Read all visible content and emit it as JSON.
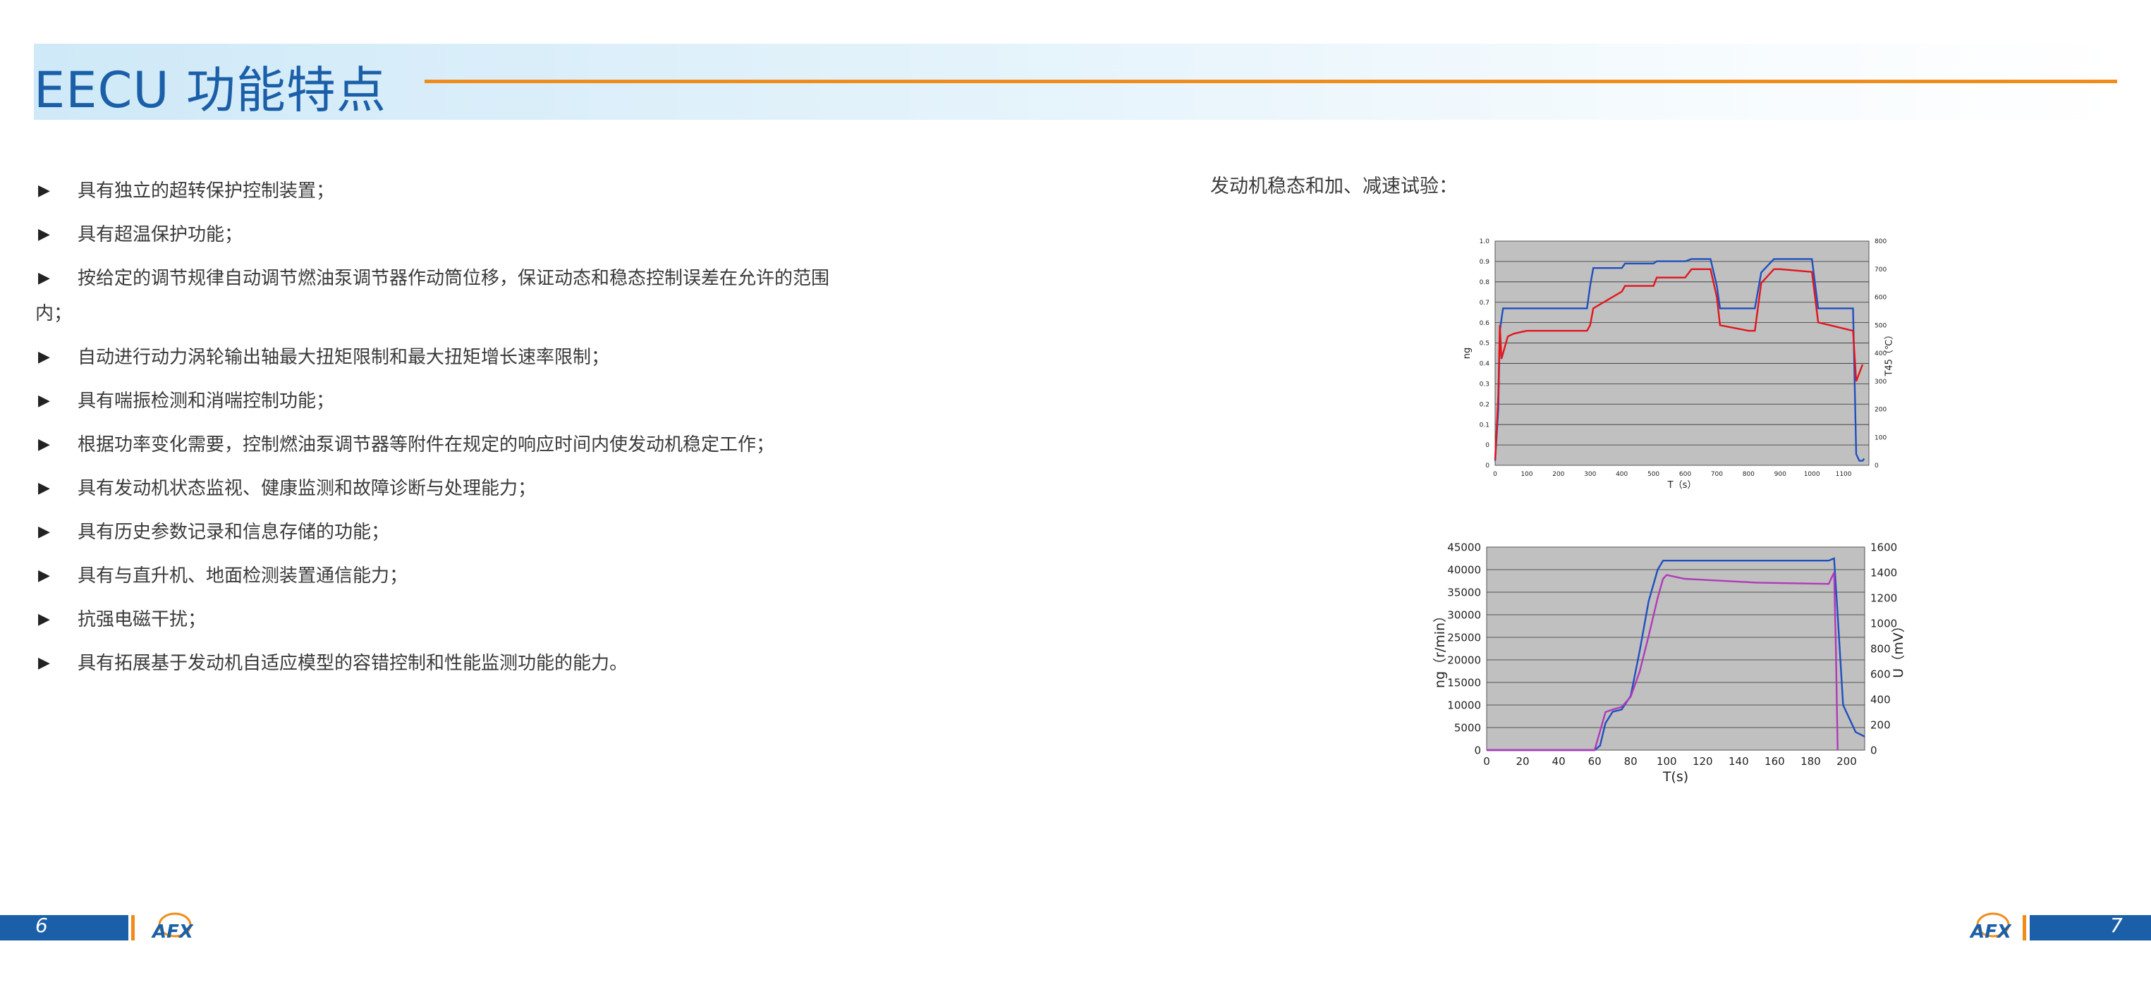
{
  "header": {
    "title": "EECU 功能特点"
  },
  "features": [
    "具有独立的超转保护控制装置；",
    "具有超温保护功能；",
    "按给定的调节规律自动调节燃油泵调节器作动筒位移，保证动态和稳态控制误差在允许的范围内；",
    "自动进行动力涡轮输出轴最大扭矩限制和最大扭矩增长速率限制；",
    "具有喘振检测和消喘控制功能；",
    "根据功率变化需要，控制燃油泵调节器等附件在规定的响应时间内使发动机稳定工作；",
    "具有发动机状态监视、健康监测和故障诊断与处理能力；",
    "具有历史参数记录和信息存储的功能；",
    "具有与直升机、地面检测装置通信能力；",
    "抗强电磁干扰；",
    "具有拓展基于发动机自适应模型的容错控制和性能监测功能的能力。"
  ],
  "bullet_glyph": "▶",
  "chart_caption": "发动机稳态和加、减速试验：",
  "footer": {
    "left_page": "6",
    "right_page": "7",
    "logo_text": "AFX"
  },
  "colors": {
    "brand_blue": "#1a5fa8",
    "accent_orange": "#f08c1a",
    "plot_bg": "#c0c0c0"
  },
  "chart_data": [
    {
      "type": "line",
      "xlabel": "T（s）",
      "ylabel": "ng",
      "y2label": "T45（℃）",
      "xlim": [
        0,
        1180
      ],
      "ylim": [
        0,
        1.0
      ],
      "y2lim": [
        0,
        800
      ],
      "x_ticks": [
        "0",
        "100",
        "200",
        "300",
        "400",
        "500",
        "600",
        "700",
        "800",
        "900",
        "1000",
        "1100"
      ],
      "y_ticks": [
        "0",
        "0",
        "0.1",
        "0.2",
        "0.3",
        "0.4",
        "0.5",
        "0.6",
        "0.7",
        "0.8",
        "0.9",
        "1.0"
      ],
      "y2_ticks": [
        "0",
        "100",
        "200",
        "300",
        "400",
        "500",
        "600",
        "700",
        "800"
      ],
      "grid": true,
      "series": [
        {
          "color": "#1f4fbf",
          "axis": "left",
          "x": [
            0,
            10,
            15,
            25,
            50,
            290,
            300,
            310,
            400,
            410,
            500,
            510,
            600,
            620,
            640,
            680,
            700,
            710,
            800,
            820,
            840,
            880,
            900,
            1000,
            1020,
            1130,
            1140,
            1150,
            1160,
            1165
          ],
          "y": [
            0.02,
            0.25,
            0.6,
            0.7,
            0.7,
            0.7,
            0.8,
            0.88,
            0.88,
            0.9,
            0.9,
            0.91,
            0.91,
            0.92,
            0.92,
            0.92,
            0.8,
            0.7,
            0.7,
            0.7,
            0.86,
            0.92,
            0.92,
            0.92,
            0.7,
            0.7,
            0.05,
            0.02,
            0.02,
            0.03
          ]
        },
        {
          "color": "#e3141c",
          "axis": "right",
          "x": [
            0,
            10,
            15,
            20,
            40,
            60,
            100,
            290,
            300,
            310,
            400,
            410,
            500,
            510,
            600,
            620,
            640,
            680,
            700,
            710,
            800,
            820,
            840,
            880,
            900,
            1000,
            1020,
            1130,
            1140,
            1160
          ],
          "y": [
            20,
            250,
            500,
            380,
            460,
            470,
            480,
            480,
            500,
            560,
            620,
            640,
            640,
            670,
            670,
            700,
            700,
            700,
            600,
            500,
            480,
            480,
            650,
            700,
            700,
            690,
            510,
            480,
            300,
            360
          ]
        }
      ]
    },
    {
      "type": "line",
      "xlabel": "T(s)",
      "ylabel": "ng（r/min）",
      "y2label": "U（mV）",
      "xlim": [
        0,
        210
      ],
      "ylim": [
        0,
        45000
      ],
      "y2lim": [
        0,
        1600
      ],
      "x_ticks": [
        "0",
        "20",
        "40",
        "60",
        "80",
        "100",
        "120",
        "140",
        "160",
        "180",
        "200"
      ],
      "y_ticks": [
        "0",
        "5000",
        "10000",
        "15000",
        "20000",
        "25000",
        "30000",
        "35000",
        "40000",
        "45000"
      ],
      "y2_ticks": [
        "0",
        "200",
        "400",
        "600",
        "800",
        "1000",
        "1200",
        "1400",
        "1600"
      ],
      "grid": true,
      "series": [
        {
          "color": "#1f4fbf",
          "axis": "left",
          "x": [
            0,
            60,
            63,
            66,
            70,
            75,
            80,
            85,
            90,
            95,
            98,
            100,
            150,
            190,
            193,
            195,
            198,
            205,
            210
          ],
          "y": [
            0,
            0,
            1000,
            6000,
            8500,
            9000,
            12000,
            22000,
            33000,
            40000,
            42000,
            42000,
            42000,
            42000,
            42500,
            30000,
            10000,
            4000,
            3000
          ]
        },
        {
          "color": "#b03ab8",
          "axis": "right",
          "x": [
            0,
            60,
            62,
            64,
            66,
            70,
            75,
            80,
            85,
            90,
            95,
            98,
            100,
            110,
            150,
            190,
            193,
            194,
            195
          ],
          "y": [
            0,
            0,
            100,
            200,
            300,
            320,
            340,
            420,
            620,
            900,
            1200,
            1350,
            1380,
            1350,
            1320,
            1310,
            1400,
            800,
            0
          ]
        }
      ]
    }
  ]
}
